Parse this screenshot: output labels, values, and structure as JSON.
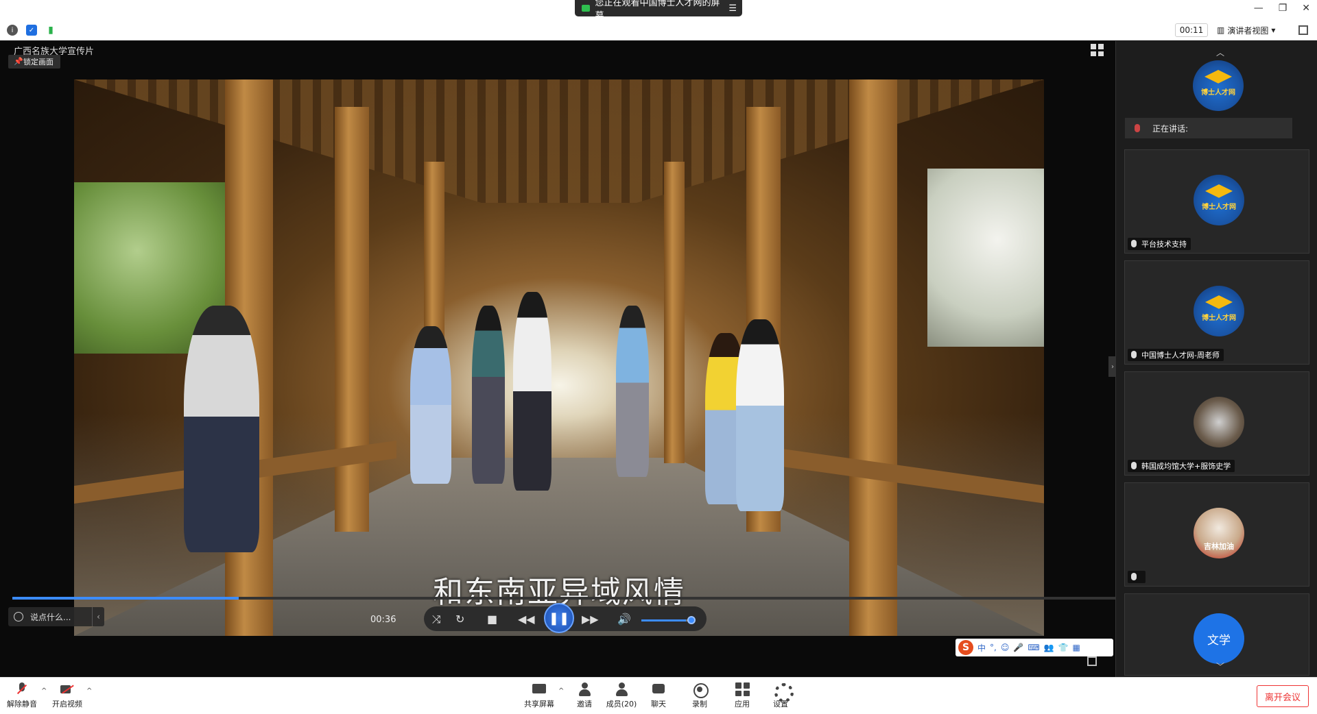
{
  "banner": {
    "text": "您正在观看中国博士人才网的屏幕"
  },
  "toolbar": {
    "timer": "00:11",
    "view_mode": "演讲者视图"
  },
  "stage": {
    "title": "广西名族大学宣传片",
    "lock_label": "锁定画面",
    "subtitle": "和东南亚异域风情",
    "chat_placeholder": "说点什么..."
  },
  "player": {
    "current_time": "00:36",
    "progress": 0.205,
    "volume": 0.9
  },
  "ime": {
    "mode_label": "中"
  },
  "panel": {
    "speaking_label": "正在讲话:",
    "participants": [
      {
        "name": "平台技术支持",
        "avatar": "logo"
      },
      {
        "name": "中国博士人才网-周老师",
        "avatar": "logo"
      },
      {
        "name": "韩国成均馆大学+服饰史学",
        "avatar": "photo"
      },
      {
        "name": "",
        "avatar": "violin",
        "avatar_text": "吉林加油"
      },
      {
        "name": "",
        "avatar": "text",
        "avatar_text": "文学"
      }
    ],
    "logo_text": "博士人才网"
  },
  "bottombar": {
    "unmute": "解除静音",
    "start_video": "开启视频",
    "share_screen": "共享屏幕",
    "invite": "邀请",
    "members": "成员(20)",
    "chat": "聊天",
    "record": "录制",
    "apps": "应用",
    "settings": "设置",
    "leave": "离开会议"
  }
}
